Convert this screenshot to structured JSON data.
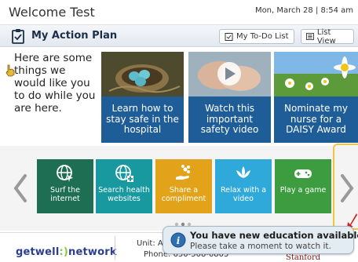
{
  "header": {
    "welcome": "Welcome Test",
    "datetime": "Mon, March 28 | 8:54 am"
  },
  "plan_bar": {
    "title": "My Action Plan",
    "todo_label": "My To-Do List",
    "list_view_label": "List View"
  },
  "intro_text": "Here are some things we would like you to do while you are here.",
  "videos": [
    {
      "caption": "Learn how to stay safe in the hospital",
      "thumb": "bird-nest-eggs"
    },
    {
      "caption": "Watch this important safety video",
      "thumb": "washing-hands"
    },
    {
      "caption": "Nominate my nurse for a DAISY Award",
      "thumb": "daisy-flowers"
    }
  ],
  "tiles": [
    {
      "label": "Surf the internet",
      "icon": "globe-cursor-icon",
      "color": "#1d6e52"
    },
    {
      "label": "Search health websites",
      "icon": "globe-plus-icon",
      "color": "#18999f"
    },
    {
      "label": "Share a compliment",
      "icon": "flower-hand-icon",
      "color": "#e2a31a"
    },
    {
      "label": "Relax with a video",
      "icon": "lotus-icon",
      "color": "#2fa9d9"
    },
    {
      "label": "Play a game",
      "icon": "gamepad-icon",
      "color": "#3d9c3f"
    }
  ],
  "footer": {
    "brand_a": "getwell",
    "brand_b": "network",
    "unit": "Unit: A",
    "phone": "Phone: 650-508-6805",
    "hospital": "Stanford"
  },
  "notification": {
    "title": "You have new education available!",
    "subtitle": "Please take a moment to watch it."
  },
  "colors": {
    "card_blue": "#1e5d98",
    "brand_blue": "#2a3f8f",
    "brand_green": "#8cc641",
    "highlight": "#f3c53c"
  }
}
